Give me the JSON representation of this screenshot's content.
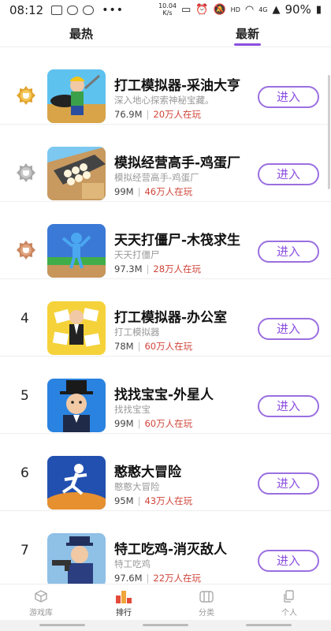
{
  "status_bar": {
    "time": "08:12",
    "speed_value": "10.04",
    "speed_unit": "K/s",
    "network": "HD",
    "signal": "4G",
    "battery": "90%"
  },
  "tabs": [
    {
      "label": "最热",
      "active": false
    },
    {
      "label": "最新",
      "active": true
    }
  ],
  "enter_label": "进入",
  "games": [
    {
      "rank": "1",
      "title": "打工模拟器-采油大亨",
      "subtitle": "深入地心探索神秘宝藏。",
      "size": "76.9M",
      "playing": "20万人在玩",
      "medal": "gold"
    },
    {
      "rank": "2",
      "title": "模拟经营高手-鸡蛋厂",
      "subtitle": "模拟经营高手-鸡蛋厂",
      "size": "99M",
      "playing": "46万人在玩",
      "medal": "silver"
    },
    {
      "rank": "3",
      "title": "天天打僵尸-木筏求生",
      "subtitle": "天天打僵尸",
      "size": "97.3M",
      "playing": "28万人在玩",
      "medal": "bronze"
    },
    {
      "rank": "4",
      "title": "打工模拟器-办公室",
      "subtitle": "打工模拟器",
      "size": "78M",
      "playing": "60万人在玩"
    },
    {
      "rank": "5",
      "title": "找找宝宝-外星人",
      "subtitle": "找找宝宝",
      "size": "99M",
      "playing": "60万人在玩"
    },
    {
      "rank": "6",
      "title": "憨憨大冒险",
      "subtitle": "憨憨大冒险",
      "size": "95M",
      "playing": "43万人在玩"
    },
    {
      "rank": "7",
      "title": "特工吃鸡-消灭敌人",
      "subtitle": "特工吃鸡",
      "size": "97.6M",
      "playing": "22万人在玩"
    }
  ],
  "bottom_nav": [
    {
      "label": "游戏库",
      "icon": "cube-icon",
      "active": false
    },
    {
      "label": "排行",
      "icon": "podium-icon",
      "active": true
    },
    {
      "label": "分类",
      "icon": "category-icon",
      "active": false
    },
    {
      "label": "个人",
      "icon": "profile-icon",
      "active": false
    }
  ],
  "colors": {
    "accent": "#8b4fe0",
    "playing_red": "#d0453a",
    "gold": "#e2a531",
    "silver": "#a9a9a9",
    "bronze": "#c98660"
  }
}
